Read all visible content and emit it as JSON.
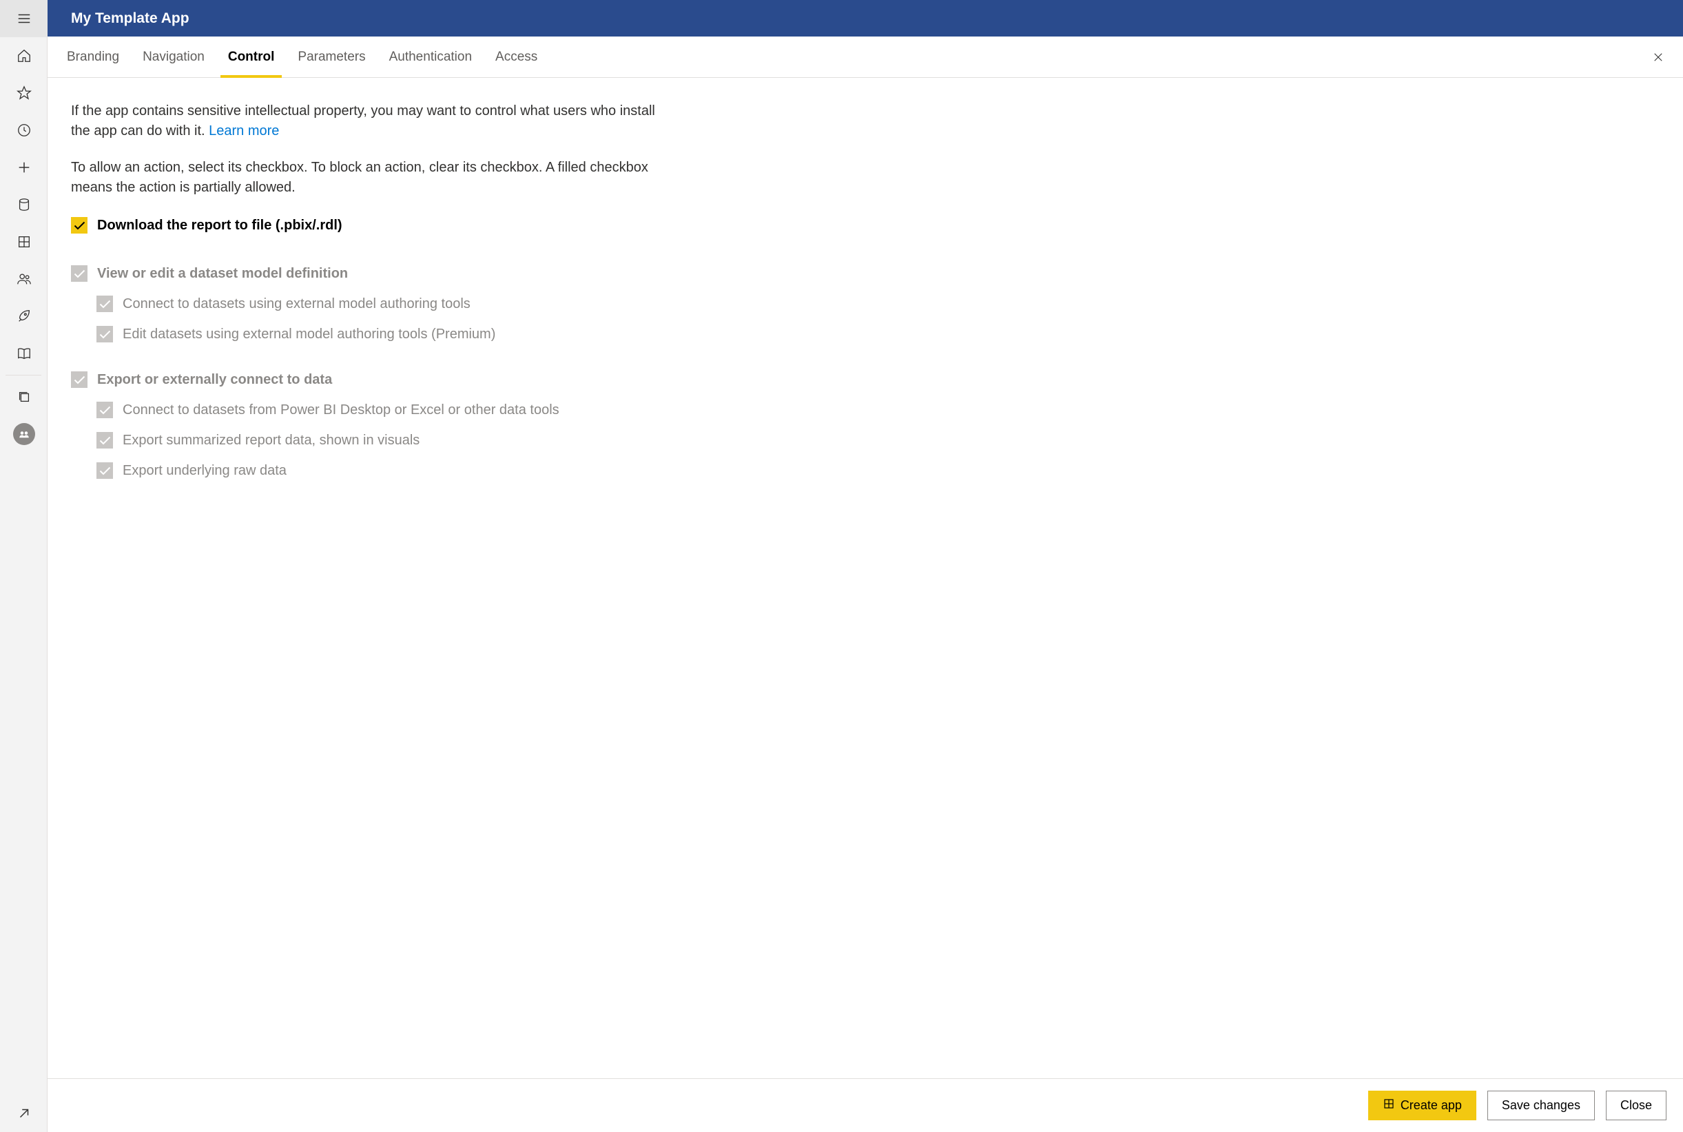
{
  "header": {
    "title": "My Template App"
  },
  "tabs": {
    "items": [
      {
        "label": "Branding"
      },
      {
        "label": "Navigation"
      },
      {
        "label": "Control"
      },
      {
        "label": "Parameters"
      },
      {
        "label": "Authentication"
      },
      {
        "label": "Access"
      }
    ],
    "active_index": 2
  },
  "content": {
    "intro_line1": "If the app contains sensitive intellectual property, you may want to control what users who install the app can do with it. ",
    "learn_more": "Learn more",
    "intro_line2": "To allow an action, select its checkbox. To block an action, clear its checkbox. A filled checkbox means the action is partially allowed.",
    "options": {
      "download": {
        "label": "Download the report to file (.pbix/.rdl)"
      },
      "view_model": {
        "label": "View or edit a dataset model definition",
        "children": [
          "Connect to datasets using external model authoring tools",
          "Edit datasets using external model authoring tools (Premium)"
        ]
      },
      "export": {
        "label": "Export or externally connect to data",
        "children": [
          "Connect to datasets from Power BI Desktop or Excel or other data tools",
          "Export summarized report data, shown in visuals",
          "Export underlying raw data"
        ]
      }
    }
  },
  "footer": {
    "create_app": "Create app",
    "save_changes": "Save changes",
    "close": "Close"
  }
}
